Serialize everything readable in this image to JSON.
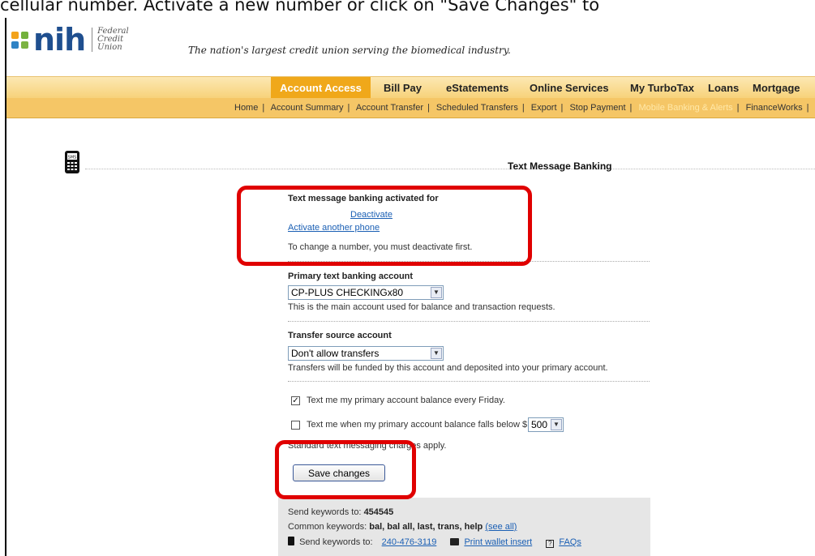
{
  "caption": "cellular number. Activate a new number or click on \"Save Changes\" to",
  "logo": {
    "word": "nih",
    "line1": "Federal",
    "line2": "Credit",
    "line3": "Union"
  },
  "tagline": "The nation's largest credit union serving the biomedical industry.",
  "main_nav": {
    "items": [
      {
        "label": "Account Access"
      },
      {
        "label": "Bill Pay"
      },
      {
        "label": "eStatements"
      },
      {
        "label": "Online Services"
      },
      {
        "label": "My TurboTax"
      },
      {
        "label": "Loans"
      },
      {
        "label": "Mortgage"
      }
    ]
  },
  "sub_nav": {
    "items": [
      {
        "label": "Home"
      },
      {
        "label": "Account Summary"
      },
      {
        "label": "Account Transfer"
      },
      {
        "label": "Scheduled Transfers"
      },
      {
        "label": "Export"
      },
      {
        "label": "Stop Payment"
      },
      {
        "label": "Mobile Banking & Alerts"
      },
      {
        "label": "FinanceWorks"
      }
    ]
  },
  "section_title": "Text Message Banking",
  "activation": {
    "heading": "Text message banking activated for",
    "deactivate": "Deactivate",
    "activate_another": "Activate another phone",
    "note": "To change a number, you must deactivate first."
  },
  "primary": {
    "heading": "Primary text banking account",
    "selected": "CP-PLUS CHECKINGx80",
    "help": "This is the main account used for balance and transaction requests."
  },
  "transfer": {
    "heading": "Transfer source account",
    "selected": "Don't allow transfers",
    "help": "Transfers will be funded by this account and deposited into your primary account."
  },
  "options": {
    "friday": "Text me my primary account balance every Friday.",
    "below": "Text me when my primary account balance falls below $",
    "below_amount": "500",
    "charges": "Standard text messaging charges apply."
  },
  "save_label": "Save changes",
  "keywords": {
    "send_label": "Send keywords to:",
    "send_number": "454545",
    "common_label": "Common keywords:",
    "common_list": "bal, bal all, last, trans, help",
    "see_all": "(see all)",
    "send_label2": "Send keywords to:",
    "phone": "240-476-3119",
    "print": "Print wallet insert",
    "faqs": "FAQs"
  },
  "colors": {
    "brand_blue": "#1f4f8f",
    "nav_orange": "#f0a81a",
    "annotation_red": "#e00000"
  }
}
